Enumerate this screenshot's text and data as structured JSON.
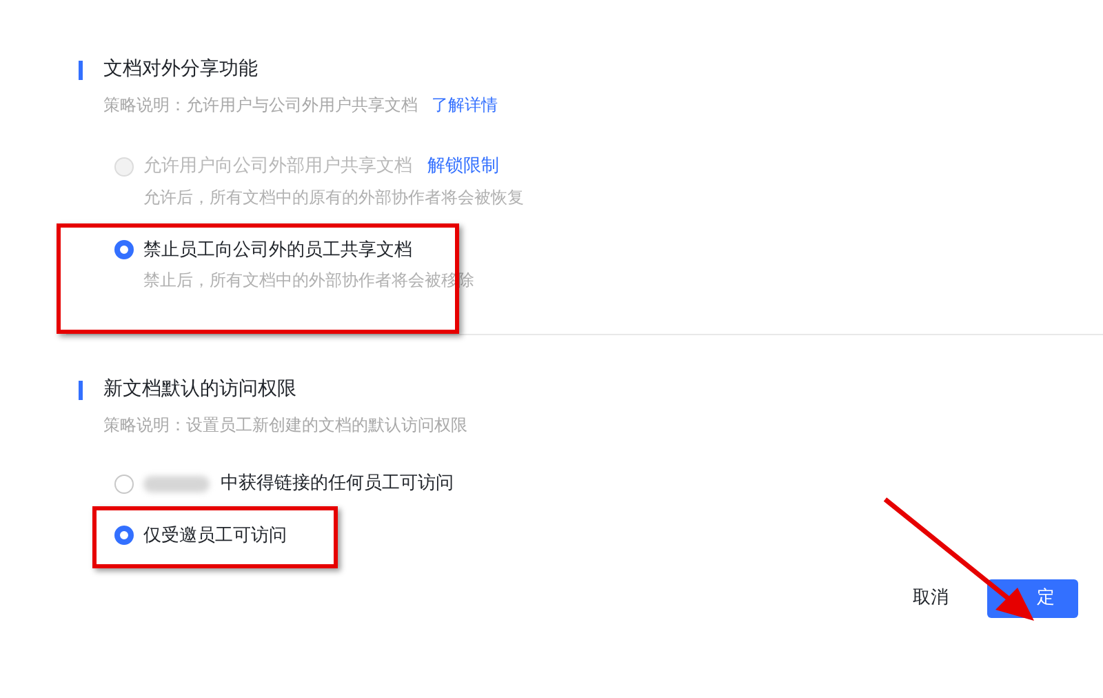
{
  "sections": [
    {
      "title": "文档对外分享功能",
      "policy": "策略说明：允许用户与公司外用户共享文档",
      "policy_link": "了解详情",
      "options": [
        {
          "label": "允许用户向公司外部用户共享文档",
          "link": "解锁限制",
          "description": "允许后，所有文档中的原有的外部协作者将会被恢复",
          "selected": false,
          "disabled": true,
          "blurred_prefix": false,
          "highlighted": false
        },
        {
          "label": "禁止员工向公司外的员工共享文档",
          "description": "禁止后，所有文档中的外部协作者将会被移除",
          "selected": true,
          "disabled": false,
          "blurred_prefix": false,
          "highlighted": true
        }
      ]
    },
    {
      "title": "新文档默认的访问权限",
      "policy": "策略说明：设置员工新创建的文档的默认访问权限",
      "options": [
        {
          "label": "中获得链接的任何员工可访问",
          "selected": false,
          "disabled": false,
          "blurred_prefix": true,
          "highlighted": false
        },
        {
          "label": "仅受邀员工可访问",
          "selected": true,
          "disabled": false,
          "blurred_prefix": false,
          "highlighted": true
        }
      ]
    }
  ],
  "buttons": [
    {
      "label": "取消",
      "kind": "secondary"
    },
    {
      "label": "定",
      "kind": "primary"
    }
  ],
  "annotation_arrow": true
}
